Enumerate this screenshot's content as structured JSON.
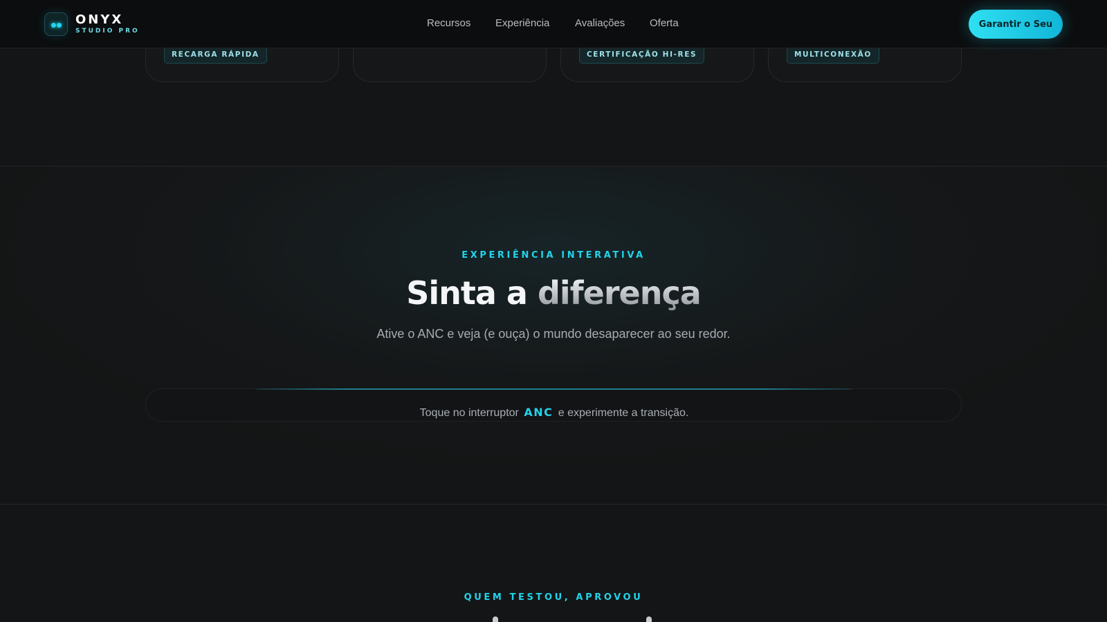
{
  "header": {
    "brand_name": "ONYX",
    "brand_sub": "STUDIO PRO",
    "nav": [
      {
        "label": "Recursos"
      },
      {
        "label": "Experiência"
      },
      {
        "label": "Avaliações"
      },
      {
        "label": "Oferta"
      }
    ],
    "cta_label": "Garantir o Seu"
  },
  "features": {
    "tags": [
      "RECARGA RÁPIDA",
      "",
      "CERTIFICAÇÃO HI-RES",
      "MULTICONEXÃO"
    ]
  },
  "experience": {
    "eyebrow": "EXPERIÊNCIA INTERATIVA",
    "title_plain": "Sinta a ",
    "title_highlight": "diferença",
    "subtitle": "Ative o ANC e veja (e ouça) o mundo desaparecer ao seu redor.",
    "hint_before": "Toque no interruptor ",
    "hint_anc": "ANC",
    "hint_after": " e experimente a transição."
  },
  "reviews": {
    "eyebrow": "QUEM TESTOU, APROVOU"
  },
  "colors": {
    "accent": "#22d3ea",
    "background": "#141516",
    "cta_gradient_start": "#2fe0f2",
    "cta_gradient_end": "#12b6d8"
  },
  "icons": {
    "logo": "earbuds-logo-icon"
  }
}
